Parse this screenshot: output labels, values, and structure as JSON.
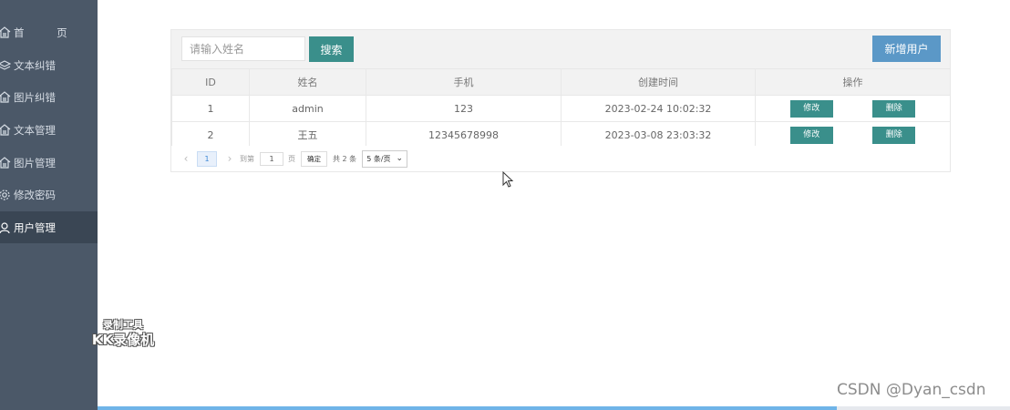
{
  "sidebar": {
    "items": [
      {
        "label": "首 页",
        "icon": "home-icon"
      },
      {
        "label": "文本纠错",
        "icon": "layers-icon"
      },
      {
        "label": "图片纠错",
        "icon": "home-icon"
      },
      {
        "label": "文本管理",
        "icon": "home-icon"
      },
      {
        "label": "图片管理",
        "icon": "home-icon"
      },
      {
        "label": "修改密码",
        "icon": "gear-icon"
      },
      {
        "label": "用户管理",
        "icon": "user-icon",
        "active": true
      }
    ]
  },
  "toolbar": {
    "search_placeholder": "请输入姓名",
    "search_label": "搜索",
    "add_label": "新增用户"
  },
  "table": {
    "columns": [
      "ID",
      "姓名",
      "手机",
      "创建时间",
      "操作"
    ],
    "rows": [
      {
        "id": "1",
        "name": "admin",
        "phone": "123",
        "created": "2023-02-24 10:02:32",
        "edit": "修改",
        "delete": "删除"
      },
      {
        "id": "2",
        "name": "王五",
        "phone": "12345678998",
        "created": "2023-03-08 23:03:32",
        "edit": "修改",
        "delete": "删除"
      }
    ]
  },
  "pager": {
    "prev": "‹",
    "current": "1",
    "next": "›",
    "goto_label": "到第",
    "goto_value": "1",
    "page_unit": "页",
    "confirm": "确定",
    "total": "共 2 条",
    "page_size": "5 条/页"
  },
  "watermarks": {
    "recorder_line1": "录制工具",
    "recorder_line2": "KK录像机",
    "csdn": "CSDN @Dyan_csdn"
  },
  "colors": {
    "sidebar_bg": "#4b5868",
    "primary_teal": "#3a8f8b",
    "add_button_blue": "#5b98c7"
  },
  "video_progress": 0.81
}
